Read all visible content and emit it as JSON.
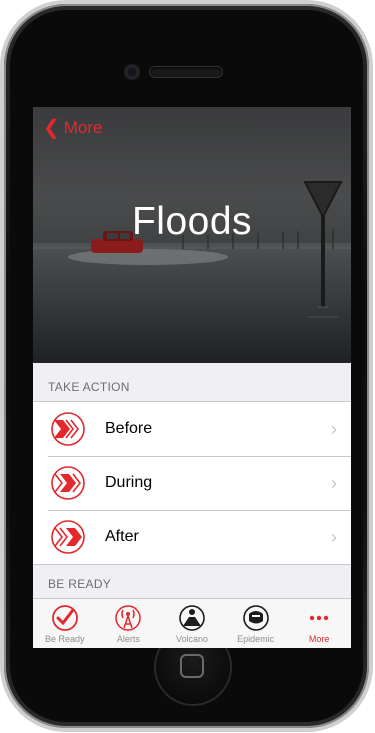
{
  "nav": {
    "back_label": "More"
  },
  "hero": {
    "title": "Floods"
  },
  "sections": {
    "take_action": "TAKE ACTION",
    "be_ready": "BE READY"
  },
  "actions": [
    {
      "label": "Before",
      "icon": "chevron-phase-icon"
    },
    {
      "label": "During",
      "icon": "chevron-phase-icon"
    },
    {
      "label": "After",
      "icon": "chevron-phase-icon"
    }
  ],
  "tabs": [
    {
      "label": "Be Ready",
      "icon": "checkmark-circle-icon"
    },
    {
      "label": "Alerts",
      "icon": "broadcast-tower-icon"
    },
    {
      "label": "Volcano",
      "icon": "volcano-icon"
    },
    {
      "label": "Epidemic",
      "icon": "mask-icon"
    },
    {
      "label": "More",
      "icon": "more-dots-icon",
      "active": true
    }
  ],
  "colors": {
    "accent": "#e4282c",
    "inactive": "#8e8e93",
    "background": "#efeff4"
  }
}
